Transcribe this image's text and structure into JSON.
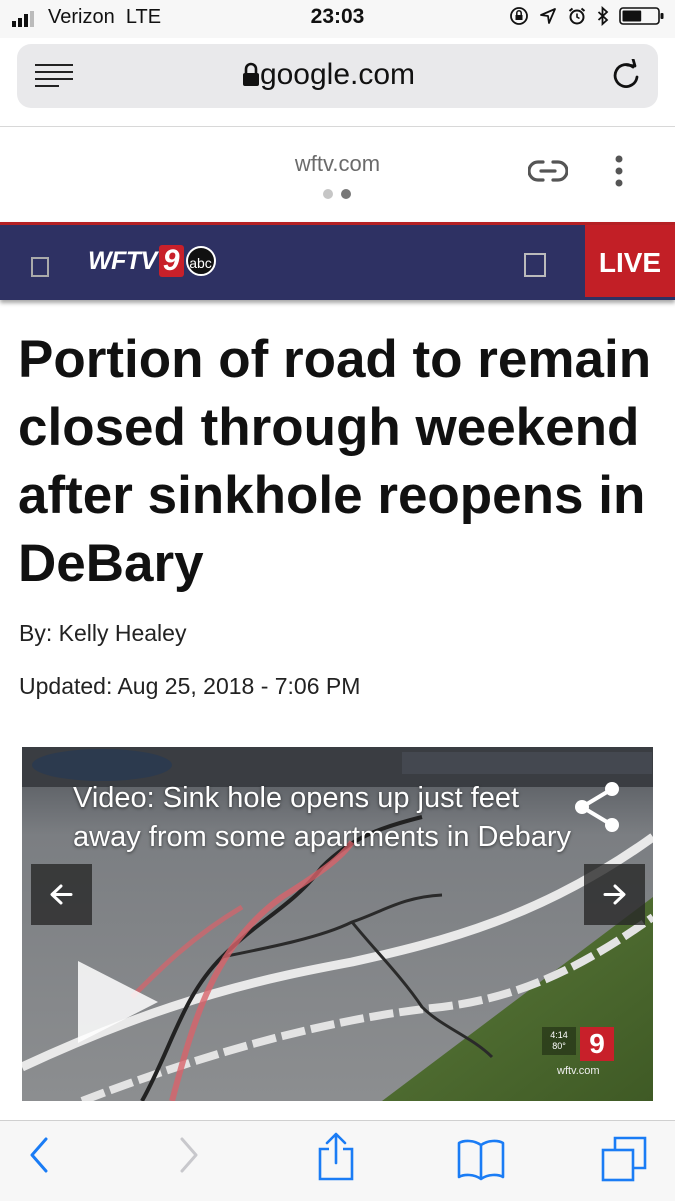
{
  "status_bar": {
    "carrier": "Verizon",
    "network": "LTE",
    "time": "23:03",
    "icons": [
      "orientation-lock-icon",
      "location-icon",
      "alarm-icon",
      "bluetooth-icon",
      "battery-icon"
    ],
    "battery_level": 0.55
  },
  "browser": {
    "address": "google.com",
    "amp_domain": "wftv.com",
    "page_indicator": {
      "count": 2,
      "active": 2
    }
  },
  "site_header": {
    "logo_text": "WFTV",
    "logo_number": "9",
    "logo_network": "abc",
    "live_label": "LIVE",
    "colors": {
      "bar": "#2e3163",
      "accent": "#c21f26"
    }
  },
  "article": {
    "headline": "Portion of road to remain closed through weekend after sinkhole reopens in DeBary",
    "byline": "By: Kelly Healey",
    "updated": "Updated: Aug 25, 2018 - 7:06 PM"
  },
  "video": {
    "caption": "Video: Sink hole opens up just feet away from some apartments in Debary",
    "bug_time": "4:14",
    "bug_temp": "80°",
    "bug_number": "9",
    "bug_site": "wftv.com"
  },
  "toolbar": {
    "icons": [
      "back-icon",
      "forward-icon",
      "share-icon",
      "bookmarks-icon",
      "tabs-icon"
    ]
  }
}
